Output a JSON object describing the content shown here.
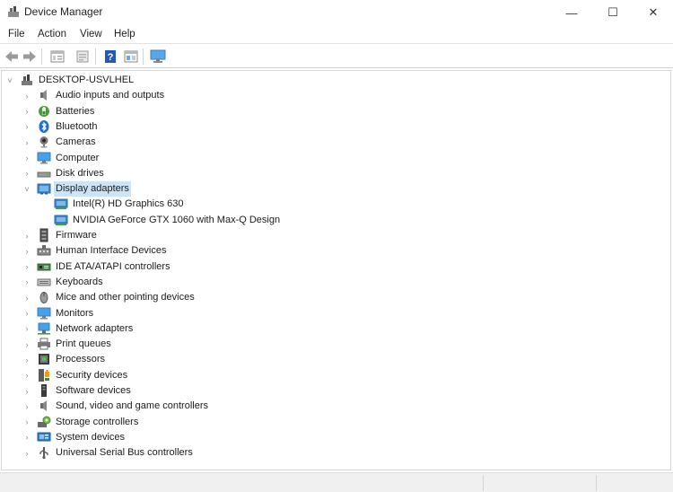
{
  "window": {
    "title": "Device Manager",
    "minimize_glyph": "—",
    "maximize_glyph": "☐",
    "close_glyph": "✕"
  },
  "menu": [
    "File",
    "Action",
    "View",
    "Help"
  ],
  "toolbar": {
    "buttons": [
      "back-arrow-icon",
      "forward-arrow-icon",
      "properties-view-icon",
      "properties-sheet-icon",
      "help-icon",
      "view-details-icon",
      "monitor-scan-icon"
    ]
  },
  "tree": {
    "root": "DESKTOP-USVLHEL",
    "categories": [
      {
        "label": "Audio inputs and outputs",
        "icon": "speaker-icon"
      },
      {
        "label": "Batteries",
        "icon": "battery-icon"
      },
      {
        "label": "Bluetooth",
        "icon": "bluetooth-icon"
      },
      {
        "label": "Cameras",
        "icon": "camera-icon"
      },
      {
        "label": "Computer",
        "icon": "computer-icon"
      },
      {
        "label": "Disk drives",
        "icon": "disk-drive-icon"
      },
      {
        "label": "Display adapters",
        "icon": "display-adapter-icon",
        "expanded": true,
        "selected": true,
        "children": [
          "Intel(R) HD Graphics 630",
          "NVIDIA GeForce GTX 1060 with Max-Q Design"
        ]
      },
      {
        "label": "Firmware",
        "icon": "firmware-icon"
      },
      {
        "label": "Human Interface Devices",
        "icon": "hid-icon"
      },
      {
        "label": "IDE ATA/ATAPI controllers",
        "icon": "ide-controller-icon"
      },
      {
        "label": "Keyboards",
        "icon": "keyboard-icon"
      },
      {
        "label": "Mice and other pointing devices",
        "icon": "mouse-icon"
      },
      {
        "label": "Monitors",
        "icon": "monitor-icon"
      },
      {
        "label": "Network adapters",
        "icon": "network-adapter-icon"
      },
      {
        "label": "Print queues",
        "icon": "printer-icon"
      },
      {
        "label": "Processors",
        "icon": "processor-icon"
      },
      {
        "label": "Security devices",
        "icon": "security-device-icon"
      },
      {
        "label": "Software devices",
        "icon": "software-device-icon"
      },
      {
        "label": "Sound, video and game controllers",
        "icon": "sound-controller-icon"
      },
      {
        "label": "Storage controllers",
        "icon": "storage-controller-icon"
      },
      {
        "label": "System devices",
        "icon": "system-device-icon"
      },
      {
        "label": "Universal Serial Bus controllers",
        "icon": "usb-icon"
      }
    ]
  },
  "colors": {
    "selection": "#cce4f7",
    "accent_blue": "#1e78d7",
    "monitor_blue": "#3a8fd6"
  }
}
